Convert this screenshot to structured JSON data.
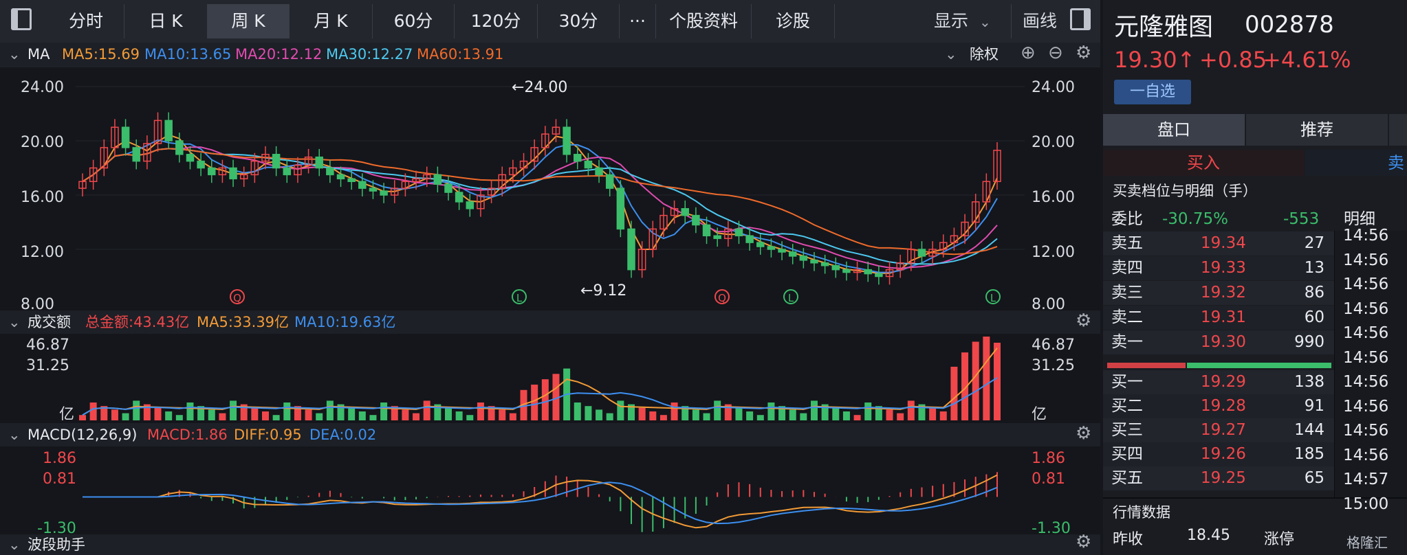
{
  "toolbar": {
    "tabs": [
      {
        "label": "分时"
      },
      {
        "label": "日 K"
      },
      {
        "label": "周 K"
      },
      {
        "label": "月 K"
      },
      {
        "label": "60分"
      },
      {
        "label": "120分"
      },
      {
        "label": "30分"
      },
      {
        "label": "···"
      },
      {
        "label": "个股资料"
      },
      {
        "label": "诊股"
      }
    ],
    "display_label": "显示",
    "draw_label": "画线"
  },
  "ma_header": {
    "title": "MA",
    "ma5": "MA5:15.69",
    "ma10": "MA10:13.65",
    "ma20": "MA20:12.12",
    "ma30": "MA30:12.27",
    "ma60": "MA60:13.91",
    "adjust": "除权"
  },
  "volume_header": {
    "title": "成交额",
    "total": "总金额:43.43亿",
    "ma5": "MA5:33.39亿",
    "ma10": "MA10:19.63亿"
  },
  "macd_header": {
    "title": "MACD(12,26,9)",
    "macd": "MACD:1.86",
    "diff": "DIFF:0.95",
    "dea": "DEA:0.02"
  },
  "wave_header": {
    "title": "波段助手"
  },
  "chart_data": [
    {
      "type": "candlestick",
      "y_ticks": [
        "24.00",
        "20.00",
        "16.00",
        "12.00",
        "8.00"
      ],
      "ylim": [
        8,
        24
      ],
      "annotations": {
        "high": "←24.00",
        "low": "←9.12"
      },
      "markers": [
        "Q",
        "L",
        "Q",
        "L",
        "L"
      ],
      "series": [
        {
          "name": "MA5",
          "value": 15.69,
          "color": "#f39b37"
        },
        {
          "name": "MA10",
          "value": 13.65,
          "color": "#3d8ff0"
        },
        {
          "name": "MA20",
          "value": 12.12,
          "color": "#e14bb0"
        },
        {
          "name": "MA30",
          "value": 12.27,
          "color": "#4dc9f0"
        },
        {
          "name": "MA60",
          "value": 13.91,
          "color": "#f06a2b"
        }
      ]
    },
    {
      "type": "bar",
      "y_ticks": [
        "46.87",
        "31.25",
        "亿"
      ],
      "ylim": [
        0,
        46.87
      ]
    },
    {
      "type": "bar",
      "y_ticks": [
        "1.86",
        "0.81",
        "-1.30"
      ],
      "ylim": [
        -1.3,
        1.86
      ]
    }
  ],
  "quote": {
    "name": "元隆雅图",
    "code": "002878",
    "price": "19.30↑",
    "change": "+0.85",
    "pct": "+4.61%",
    "watch_btn": "一自选",
    "tab_handicap": "盘口",
    "tab_recommend": "推荐",
    "buy_in": "买入",
    "sell_out": "卖",
    "levels_title": "买卖档位与明细（手）",
    "weibi_label": "委比",
    "weibi_pct": "-30.75%",
    "weibi_diff": "-553",
    "detail_label": "明细",
    "asks": [
      {
        "label": "卖五",
        "price": "19.34",
        "vol": "27"
      },
      {
        "label": "卖四",
        "price": "19.33",
        "vol": "13"
      },
      {
        "label": "卖三",
        "price": "19.32",
        "vol": "86"
      },
      {
        "label": "卖二",
        "price": "19.31",
        "vol": "60"
      },
      {
        "label": "卖一",
        "price": "19.30",
        "vol": "990"
      }
    ],
    "bids": [
      {
        "label": "买一",
        "price": "19.29",
        "vol": "138"
      },
      {
        "label": "买二",
        "price": "19.28",
        "vol": "91"
      },
      {
        "label": "买三",
        "price": "19.27",
        "vol": "144"
      },
      {
        "label": "买四",
        "price": "19.26",
        "vol": "185"
      },
      {
        "label": "买五",
        "price": "19.25",
        "vol": "65"
      }
    ],
    "times": [
      "14:56",
      "14:56",
      "14:56",
      "14:56",
      "14:56",
      "14:56",
      "14:56",
      "14:56",
      "14:56",
      "14:56",
      "14:57",
      "15:00"
    ],
    "market_title": "行情数据",
    "prev_close_label": "昨收",
    "prev_close": "18.45",
    "limit_up_label": "涨停",
    "watermark": "格隆汇"
  }
}
